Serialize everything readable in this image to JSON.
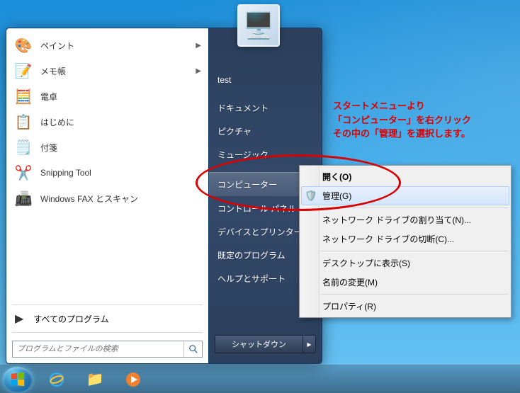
{
  "start_menu": {
    "programs": [
      {
        "icon": "🎨",
        "label": "ペイント",
        "has_submenu": true
      },
      {
        "icon": "📝",
        "label": "メモ帳",
        "has_submenu": true
      },
      {
        "icon": "🧮",
        "label": "電卓",
        "has_submenu": false
      },
      {
        "icon": "📋",
        "label": "はじめに",
        "has_submenu": false
      },
      {
        "icon": "🗒️",
        "label": "付箋",
        "has_submenu": false
      },
      {
        "icon": "✂️",
        "label": "Snipping Tool",
        "has_submenu": false
      },
      {
        "icon": "📠",
        "label": "Windows FAX とスキャン",
        "has_submenu": false
      }
    ],
    "all_programs": "すべてのプログラム",
    "search_placeholder": "プログラムとファイルの検索",
    "right_items": [
      {
        "label": "test",
        "gap_after": true
      },
      {
        "label": "ドキュメント"
      },
      {
        "label": "ピクチャ"
      },
      {
        "label": "ミュージック",
        "gap_after": true
      },
      {
        "label": "コンピューター",
        "selected": true
      },
      {
        "label": "コントロール パネル"
      },
      {
        "label": "デバイスとプリンター"
      },
      {
        "label": "既定のプログラム"
      },
      {
        "label": "ヘルプとサポート"
      }
    ],
    "shutdown": "シャットダウン",
    "user_icon": "🖥️"
  },
  "context_menu": {
    "items": [
      {
        "label": "開く(O)",
        "bold": true
      },
      {
        "label": "管理(G)",
        "icon": "🛡️",
        "highlighted": true,
        "sep_after": true
      },
      {
        "label": "ネットワーク ドライブの割り当て(N)..."
      },
      {
        "label": "ネットワーク ドライブの切断(C)...",
        "sep_after": true
      },
      {
        "label": "デスクトップに表示(S)"
      },
      {
        "label": "名前の変更(M)",
        "sep_after": true
      },
      {
        "label": "プロパティ(R)"
      }
    ]
  },
  "annotation": {
    "line1": "スタートメニューより",
    "line2": "「コンピューター」を右クリック",
    "line3": "その中の「管理」を選択します。"
  },
  "taskbar": {
    "items": [
      {
        "name": "ie-icon",
        "glyph": "e"
      },
      {
        "name": "explorer-icon",
        "glyph": "📁"
      },
      {
        "name": "media-player-icon",
        "glyph": "▶"
      }
    ]
  }
}
